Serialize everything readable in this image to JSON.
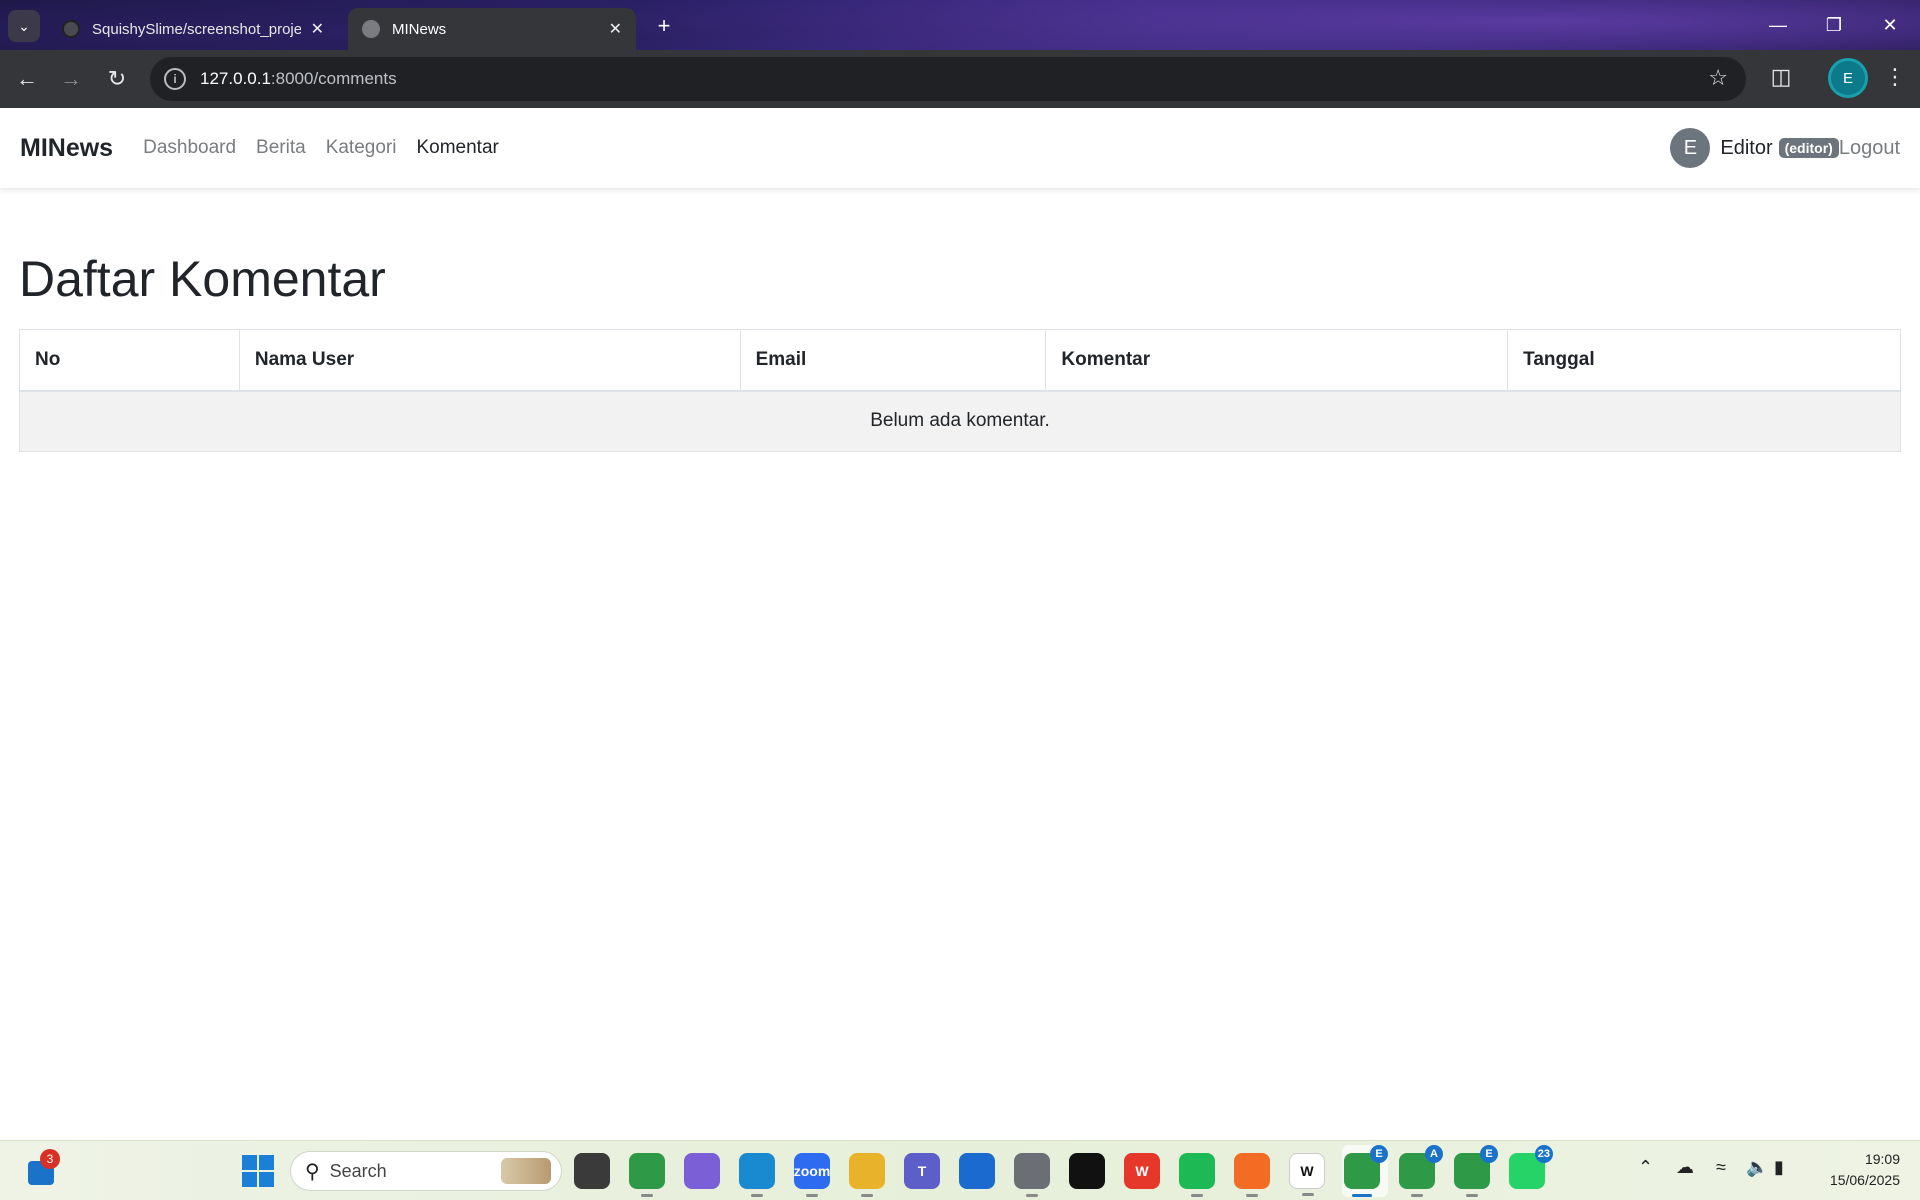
{
  "browser": {
    "tabs": [
      {
        "title": "SquishySlime/screenshot_proje",
        "active": false
      },
      {
        "title": "MINews",
        "active": true
      }
    ],
    "url_host": "127.0.0.1",
    "url_path": ":8000/comments",
    "profile_initial": "E"
  },
  "navbar": {
    "brand": "MINews",
    "links": [
      "Dashboard",
      "Berita",
      "Kategori",
      "Komentar"
    ],
    "active_link": "Komentar",
    "avatar_initial": "E",
    "user_name": "Editor",
    "role": "(editor)",
    "logout": "Logout"
  },
  "main": {
    "title": "Daftar Komentar",
    "columns": [
      "No",
      "Nama User",
      "Email",
      "Komentar",
      "Tanggal"
    ],
    "empty_message": "Belum ada komentar."
  },
  "taskbar": {
    "widget_badge": "3",
    "search_placeholder": "Search",
    "apps": [
      {
        "name": "task-view",
        "color": "#3a3a3a"
      },
      {
        "name": "chrome",
        "color": "#2e9a48"
      },
      {
        "name": "copilot",
        "color": "#7a5fd6"
      },
      {
        "name": "edge",
        "color": "#1a8ad0"
      },
      {
        "name": "zoom",
        "color": "#2d6cf0",
        "label": "zoom"
      },
      {
        "name": "file-explorer",
        "color": "#e8b32a"
      },
      {
        "name": "teams",
        "color": "#5b5fc7",
        "label": "T"
      },
      {
        "name": "microsoft-store",
        "color": "#1a6ad0"
      },
      {
        "name": "settings",
        "color": "#6b6f75"
      },
      {
        "name": "paw-app",
        "color": "#111111"
      },
      {
        "name": "wps-office",
        "color": "#e5372a",
        "label": "W"
      },
      {
        "name": "spotify",
        "color": "#1db954"
      },
      {
        "name": "xampp",
        "color": "#f36c24"
      },
      {
        "name": "notion-w",
        "color": "#ffffff",
        "label": "W"
      },
      {
        "name": "chrome-profile-e",
        "color": "#2e9a48",
        "badge": "E"
      },
      {
        "name": "chrome-profile-a",
        "color": "#2e9a48",
        "badge": "A"
      },
      {
        "name": "chrome-profile-e2",
        "color": "#2e9a48",
        "badge": "E"
      },
      {
        "name": "whatsapp",
        "color": "#25d366",
        "badge": "23"
      }
    ],
    "time": "19:09",
    "date": "15/06/2025"
  }
}
